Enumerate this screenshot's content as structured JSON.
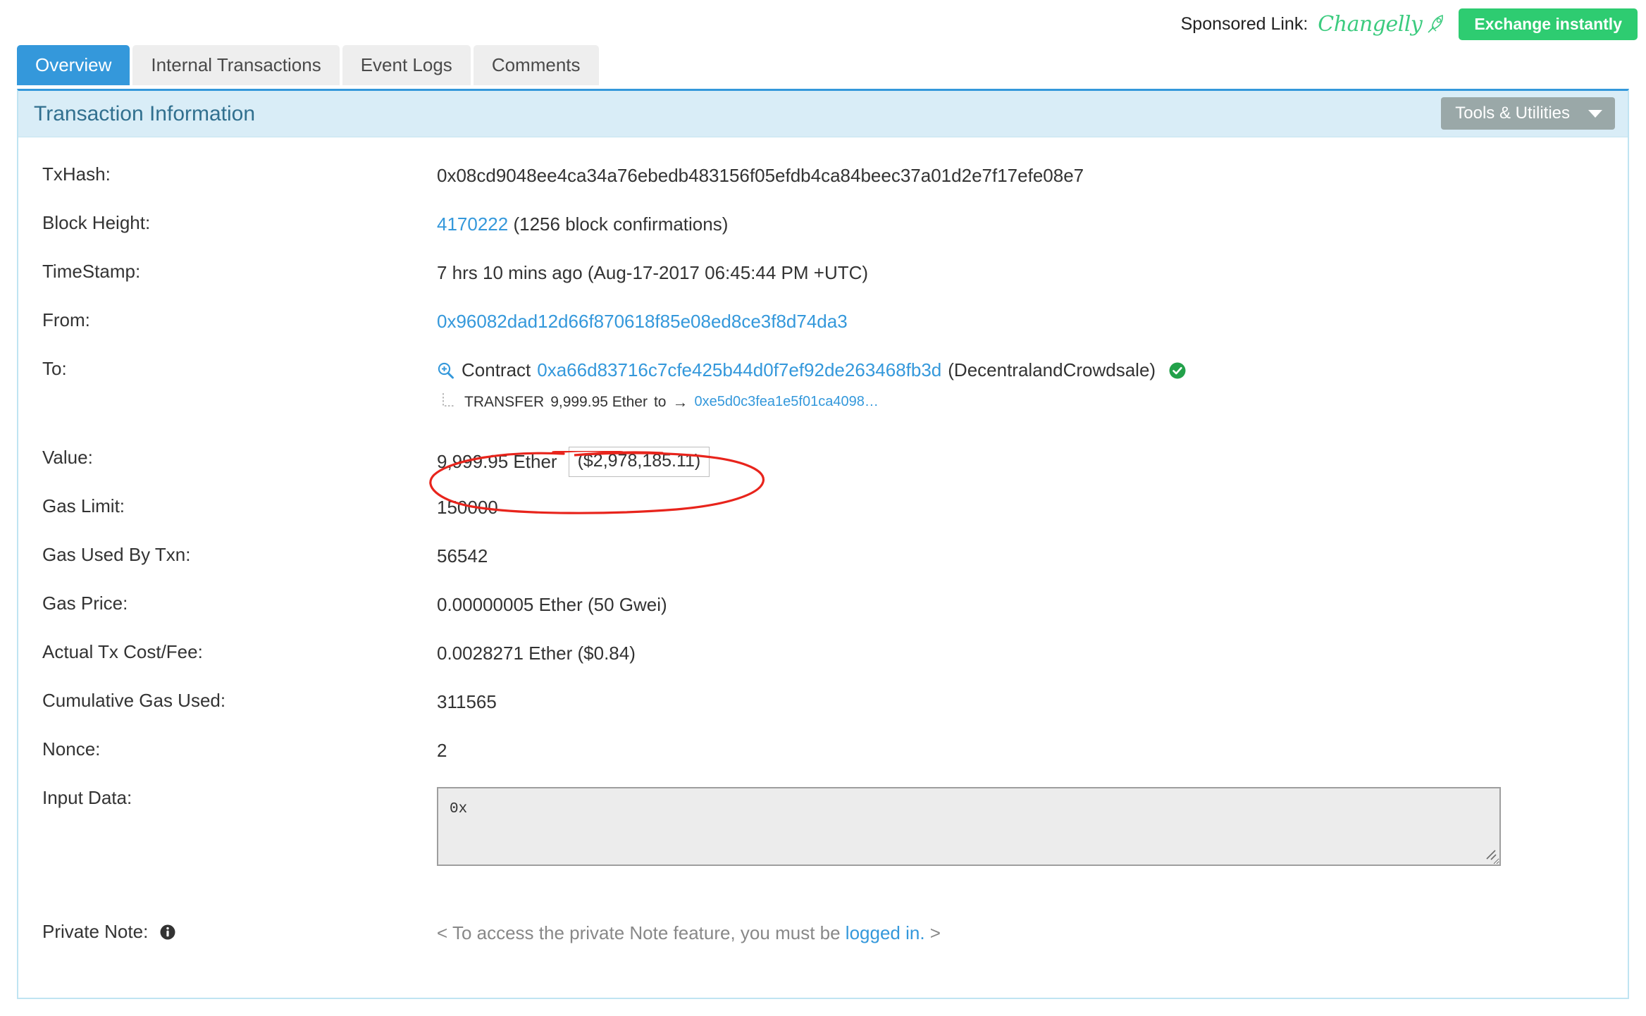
{
  "sponsor": {
    "label": "Sponsored Link:",
    "brand": "Changelly",
    "brand_icon": "rocket-icon",
    "button": "Exchange instantly",
    "button_color": "#2ecc71",
    "brand_color": "#3ccb7f"
  },
  "tabs": [
    {
      "label": "Overview",
      "active": true
    },
    {
      "label": "Internal Transactions",
      "active": false
    },
    {
      "label": "Event Logs",
      "active": false
    },
    {
      "label": "Comments",
      "active": false
    }
  ],
  "panel": {
    "title": "Transaction Information",
    "title_color": "#31708f",
    "heading_bg": "#d9edf7",
    "tools_button": "Tools & Utilities",
    "tools_caret_icon": "chevron-down-icon"
  },
  "fields": {
    "txhash_label": "TxHash:",
    "txhash_value": "0x08cd9048ee4ca34a76ebedb483156f05efdb4ca84beec37a01d2e7f17efe08e7",
    "block_label": "Block Height:",
    "block_link": "4170222",
    "block_confirmations": "(1256 block confirmations)",
    "timestamp_label": "TimeStamp:",
    "timestamp_value": "7 hrs 10 mins ago (Aug-17-2017 06:45:44 PM +UTC)",
    "from_label": "From:",
    "from_value": "0x96082dad12d66f870618f85e08ed8ce3f8d74da3",
    "to_label": "To:",
    "to_zoom_icon": "zoom-in-icon",
    "to_prefix": "Contract",
    "to_address": "0xa66d83716c7cfe425b44d0f7ef92de263468fb3d",
    "to_contract_name": "(DecentralandCrowdsale)",
    "to_verified_icon": "check-circle-icon",
    "transfer_label": "TRANSFER",
    "transfer_amount": "9,999.95 Ether",
    "transfer_to_word": "to",
    "transfer_arrow": "→",
    "transfer_address": "0xe5d0c3fea1e5f01ca4098…",
    "value_label": "Value:",
    "value_ether": "9,999.95 Ether",
    "value_usd": "($2,978,185.11)",
    "gas_limit_label": "Gas Limit:",
    "gas_limit_value": "150000",
    "gas_used_label": "Gas Used By Txn:",
    "gas_used_value": "56542",
    "gas_price_label": "Gas Price:",
    "gas_price_value": "0.00000005 Ether (50 Gwei)",
    "tx_fee_label": "Actual Tx Cost/Fee:",
    "tx_fee_value": "0.0028271 Ether ($0.84)",
    "cumulative_label": "Cumulative Gas Used:",
    "cumulative_value": "311565",
    "nonce_label": "Nonce:",
    "nonce_value": "2",
    "input_data_label": "Input Data:",
    "input_data_value": "0x",
    "private_note_label": "Private Note:",
    "private_note_icon": "info-icon",
    "private_note_prefix": "< To access the private Note feature, you must be ",
    "private_note_link": "logged in.",
    "private_note_suffix": " >"
  },
  "annotation": {
    "type": "hand-drawn-ellipse",
    "color": "#e8241c",
    "target": "value-row"
  }
}
